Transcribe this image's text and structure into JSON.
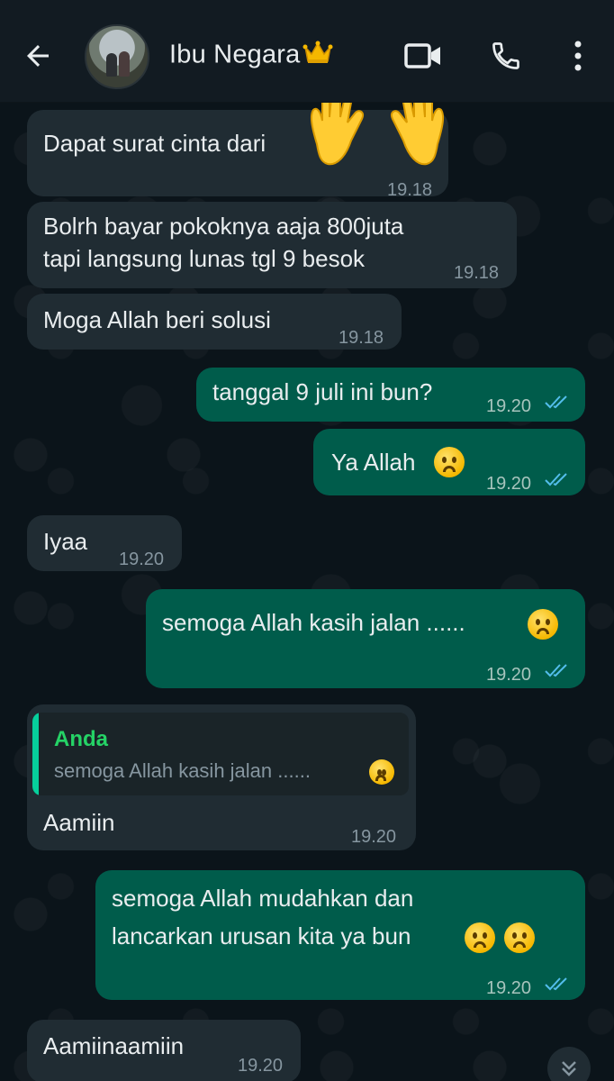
{
  "header": {
    "contact_name": "Ibu Negara",
    "crown_icon": "crown-icon",
    "icons": [
      "back-arrow-icon",
      "video-camera-icon",
      "phone-icon",
      "more-vert-icon"
    ]
  },
  "messages": [
    {
      "dir": "in",
      "text": "Dapat surat cinta dari",
      "time": "19.18"
    },
    {
      "dir": "in",
      "text_line1": "Bolrh bayar pokoknya aaja 800juta",
      "text_line2": "tapi langsung lunas tgl 9 besok",
      "time": "19.18"
    },
    {
      "dir": "in",
      "text": "Moga Allah beri solusi",
      "time": "19.18"
    },
    {
      "dir": "out",
      "text": "tanggal 9 juli ini bun?",
      "time": "19.20"
    },
    {
      "dir": "out",
      "text": "Ya Allah",
      "time": "19.20"
    },
    {
      "dir": "in",
      "text": "Iyaa",
      "time": "19.20"
    },
    {
      "dir": "out",
      "text": "semoga Allah kasih jalan ......",
      "time": "19.20"
    },
    {
      "dir": "in",
      "reply_author": "Anda",
      "reply_text": "semoga Allah kasih jalan ......",
      "text": "Aamiin",
      "time": "19.20"
    },
    {
      "dir": "out",
      "text_line1": "semoga Allah mudahkan dan",
      "text_line2": "lancarkan urusan kita ya bun",
      "time": "19.20"
    },
    {
      "dir": "in",
      "text": "Aamiinaamiin",
      "time": "19.20"
    }
  ],
  "colors": {
    "incoming": "#202c33",
    "outgoing": "#005c4b",
    "read_ticks": "#53bdeb",
    "background": "#0b141a"
  }
}
